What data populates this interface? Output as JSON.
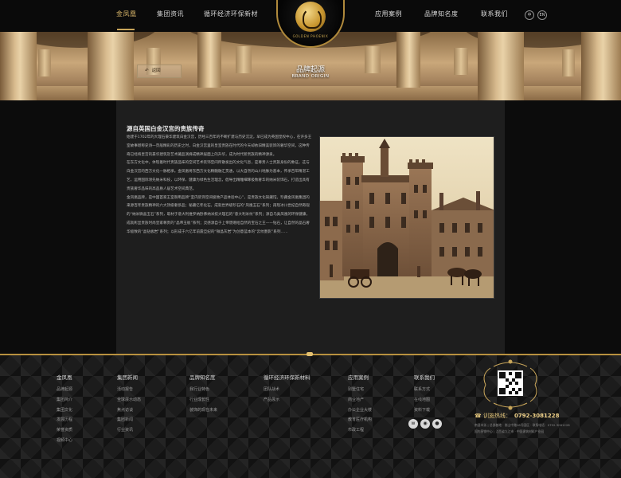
{
  "nav": {
    "items": [
      "金凤凰",
      "集团资讯",
      "循环经济环保新材",
      "应用案例",
      "品牌知名度",
      "联系我们"
    ],
    "active_index": 0
  },
  "logo": {
    "text": "GOLDEN PHOENIX"
  },
  "lang": [
    "中",
    "EN"
  ],
  "banner": {
    "title": "品牌起源",
    "subtitle": "BRAND ORIGIN",
    "back_label": "返回"
  },
  "article": {
    "title": "源自英国白金汉宫的贵族传奇",
    "paragraphs": [
      "始建于1702年的大理石豪华建筑白金汉宫，历经三百年的不断扩建与历史沉淀，早已成为英国皇权中心，在许多王室故事堪称史诗一页般精彩的历史之时，白金汉宫里的皇室贵族在时代的今天却依旧精美装饰的奢华空间，这种传奇已经将皇宫的豪华建筑及艺术藏品演绎成精神层面上的升华，成为时代新贵族的精神源泉。",
      "在东方文化中，体现着时代贵族品味的空间艺术装饰空间所散发出的文化气息，是尊贵人士贵族身份的象征，这与白金汉宫的西方文化一脉相承。金凤凰将东西方文化精髓融汇贯通，以大自然的山川地脉为基本，传承百年精湛工艺，运用国际领先纳米科技，以环保、健康为绿色生活理念，倡导出精雕细琢极致奢华的纳米装饰石，打造出具有贵族奢华品味的高品质人居艺术空间典范。",
      "金凤凰品牌，是中国首家王室御用品牌“室内装饰空间极致产品体验中心”，是贵族文化知藏馆。珍藏金凤凰集团的来源百年贵族精神的六大顶级奢侈品；秘藏亿年化石，成就世界级珍石的“凤凰玉石”系列；再现冰川世纪自然奇观的“纳米微晶玉石”系列，取材于意大利维罗纳卧佛纳米技大理石的“意大利米纹”系列；源自乌类凤凰的环保健康，成就彰显贵族时尚皇家尊贵的“晶帝玉板”系列；灵感源自于上帝馈赠给自然的宝石之王——钻石，让自然的晶石奢华极致的“晶钻板岩”系列；以形成于六亿年前震旦纪的“微晶灰岩”为创意蓝本的“云纹墨影”系列……"
    ]
  },
  "footer": {
    "columns": [
      {
        "title": "金凤凰",
        "links": [
          "品牌起源",
          "集团简介",
          "集团文化",
          "发展历程",
          "荣誉资质",
          "视频中心"
        ]
      },
      {
        "title": "集团新闻",
        "links": [
          "活动报告",
          "全球展示动态",
          "焦点访谈",
          "集团新闻",
          "行业资讯"
        ]
      },
      {
        "title": "品牌知名度",
        "links": [
          "我行业特色",
          "行业成长性",
          "装饰的现在未来"
        ]
      },
      {
        "title": "循环经济环保新材料",
        "links": [
          "团队战术",
          "产品展示"
        ]
      },
      {
        "title": "应用案例",
        "links": [
          "别墅住宅",
          "商业地产",
          "办公企业大楼",
          "教育医疗机构",
          "市政工程"
        ]
      },
      {
        "title": "联系我们",
        "links": [
          "联系方式",
          "在线地图",
          "资料下载"
        ]
      }
    ],
    "social": [
      "weibo-icon",
      "wechat-icon",
      "qq-icon"
    ],
    "hotline_label": "训施热线：",
    "hotline_number": "0792-3081228",
    "address": [
      "南昌市浙 | 总部基地 · 嵩山中路18号园区 · 联系电话：0792-3081228",
      "国内营销中心 | 江西省九江市 · 中国建筑材料产业园"
    ]
  },
  "colors": {
    "gold": "#c9a65a",
    "background": "#0b0b0b",
    "card": "#1e1e1e"
  }
}
